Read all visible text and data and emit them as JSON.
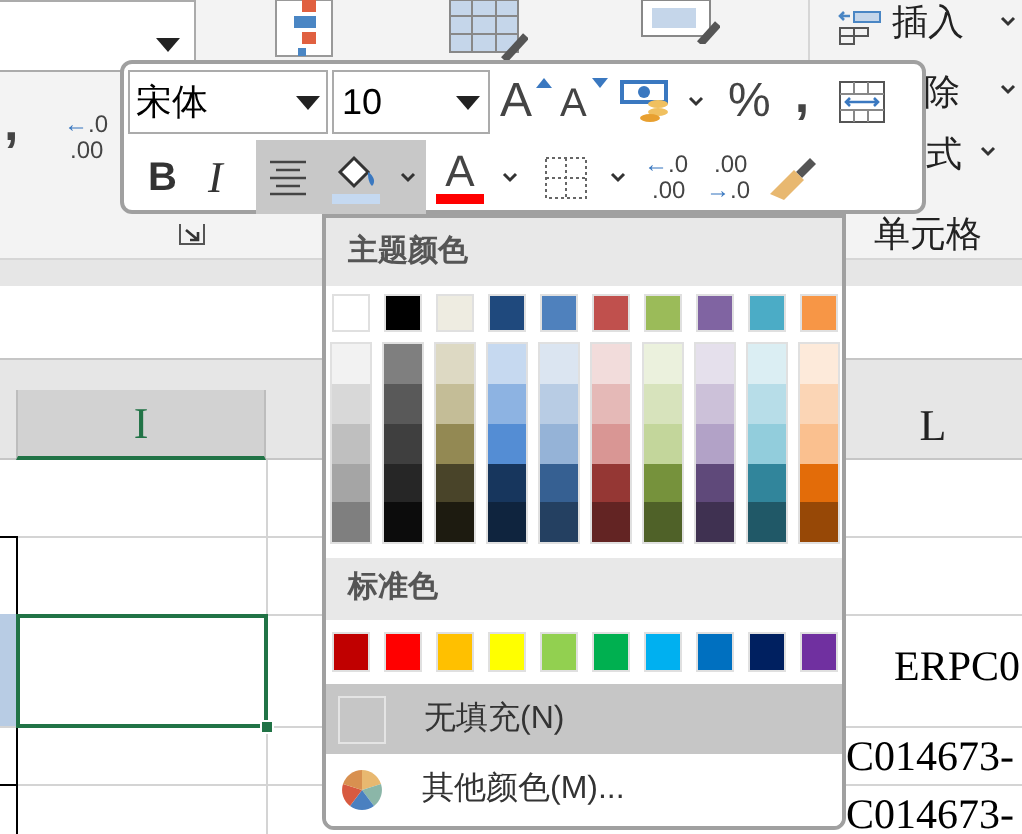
{
  "ribbon": {
    "comma_label": ",",
    "decimal_label": {
      "arrow": "←",
      "top": ".0",
      "bottom": ".00"
    },
    "cells_group": {
      "insert": "插入",
      "delete": "除",
      "format": "式",
      "title": "单元格"
    }
  },
  "mini_toolbar": {
    "font": "宋体",
    "size": "10",
    "grow_label": "A",
    "shrink_label": "A",
    "percent": "%",
    "comma": ",",
    "bold": "B",
    "italic": "I",
    "align_center": {
      "active": true
    },
    "fill_color": {
      "open": true,
      "color": "#c5d9f1"
    },
    "font_color": {
      "label": "A",
      "color": "#ff0000"
    },
    "increase_decimal": {
      "arrow": "←",
      "top": ".0",
      "bottom": ".00"
    },
    "decrease_decimal": {
      "arrow": "→",
      "top": ".00",
      "bottom": ".0"
    }
  },
  "color_menu": {
    "theme_title": "主题颜色",
    "theme_colors": [
      {
        "color": "#ffffff",
        "shades": [
          {
            "color": "#f2f2f2"
          },
          {
            "color": "#d8d8d8"
          },
          {
            "color": "#bfbfbf"
          },
          {
            "color": "#a5a5a5"
          },
          {
            "color": "#7f7f7f"
          }
        ]
      },
      {
        "color": "#000000",
        "shades": [
          {
            "color": "#7f7f7f"
          },
          {
            "color": "#595959"
          },
          {
            "color": "#3f3f3f"
          },
          {
            "color": "#262626"
          },
          {
            "color": "#0c0c0c"
          }
        ]
      },
      {
        "color": "#eeece1",
        "shades": [
          {
            "color": "#ddd9c3"
          },
          {
            "color": "#c4bd97"
          },
          {
            "color": "#938953"
          },
          {
            "color": "#494429"
          },
          {
            "color": "#1d1b10"
          }
        ]
      },
      {
        "color": "#1f497d",
        "shades": [
          {
            "color": "#c6d9f0"
          },
          {
            "color": "#8db3e2"
          },
          {
            "color": "#548dd4"
          },
          {
            "color": "#17365d"
          },
          {
            "color": "#0f243e"
          }
        ]
      },
      {
        "color": "#4f81bd",
        "shades": [
          {
            "color": "#dbe5f1"
          },
          {
            "color": "#b8cce4"
          },
          {
            "color": "#95b3d7"
          },
          {
            "color": "#366092"
          },
          {
            "color": "#244061"
          }
        ]
      },
      {
        "color": "#c0504d",
        "shades": [
          {
            "color": "#f2dcdb"
          },
          {
            "color": "#e5b9b7"
          },
          {
            "color": "#d99694"
          },
          {
            "color": "#953734"
          },
          {
            "color": "#632423"
          }
        ]
      },
      {
        "color": "#9bbb59",
        "shades": [
          {
            "color": "#ebf1dd"
          },
          {
            "color": "#d7e3bc"
          },
          {
            "color": "#c3d69b"
          },
          {
            "color": "#76923c"
          },
          {
            "color": "#4f6128"
          }
        ]
      },
      {
        "color": "#8064a2",
        "shades": [
          {
            "color": "#e5e0ec"
          },
          {
            "color": "#ccc1d9"
          },
          {
            "color": "#b2a2c7"
          },
          {
            "color": "#5f497a"
          },
          {
            "color": "#3f3151"
          }
        ]
      },
      {
        "color": "#4bacc6",
        "shades": [
          {
            "color": "#dbeef3"
          },
          {
            "color": "#b7dde8"
          },
          {
            "color": "#92cddc"
          },
          {
            "color": "#31859b"
          },
          {
            "color": "#205867"
          }
        ]
      },
      {
        "color": "#f79646",
        "shades": [
          {
            "color": "#fdeada"
          },
          {
            "color": "#fbd5b5"
          },
          {
            "color": "#fac08f"
          },
          {
            "color": "#e36c09"
          },
          {
            "color": "#974806"
          }
        ]
      }
    ],
    "standard_title": "标准色",
    "standard_colors": [
      {
        "color": "#c00000"
      },
      {
        "color": "#ff0000"
      },
      {
        "color": "#ffc000"
      },
      {
        "color": "#ffff00"
      },
      {
        "color": "#92d050"
      },
      {
        "color": "#00b050"
      },
      {
        "color": "#00b0f0"
      },
      {
        "color": "#0070c0"
      },
      {
        "color": "#002060"
      },
      {
        "color": "#7030a0"
      }
    ],
    "items": [
      {
        "kind": "no_fill",
        "label": "无填充(N)",
        "selected": true
      },
      {
        "kind": "more",
        "label": "其他颜色(M)...",
        "selected": false
      }
    ]
  },
  "sheet": {
    "columns": [
      {
        "label": "I",
        "selected": true
      },
      {
        "label": "L",
        "selected": false
      }
    ],
    "cells": [
      "ERPC0",
      "C014673-",
      "C014673-"
    ]
  }
}
